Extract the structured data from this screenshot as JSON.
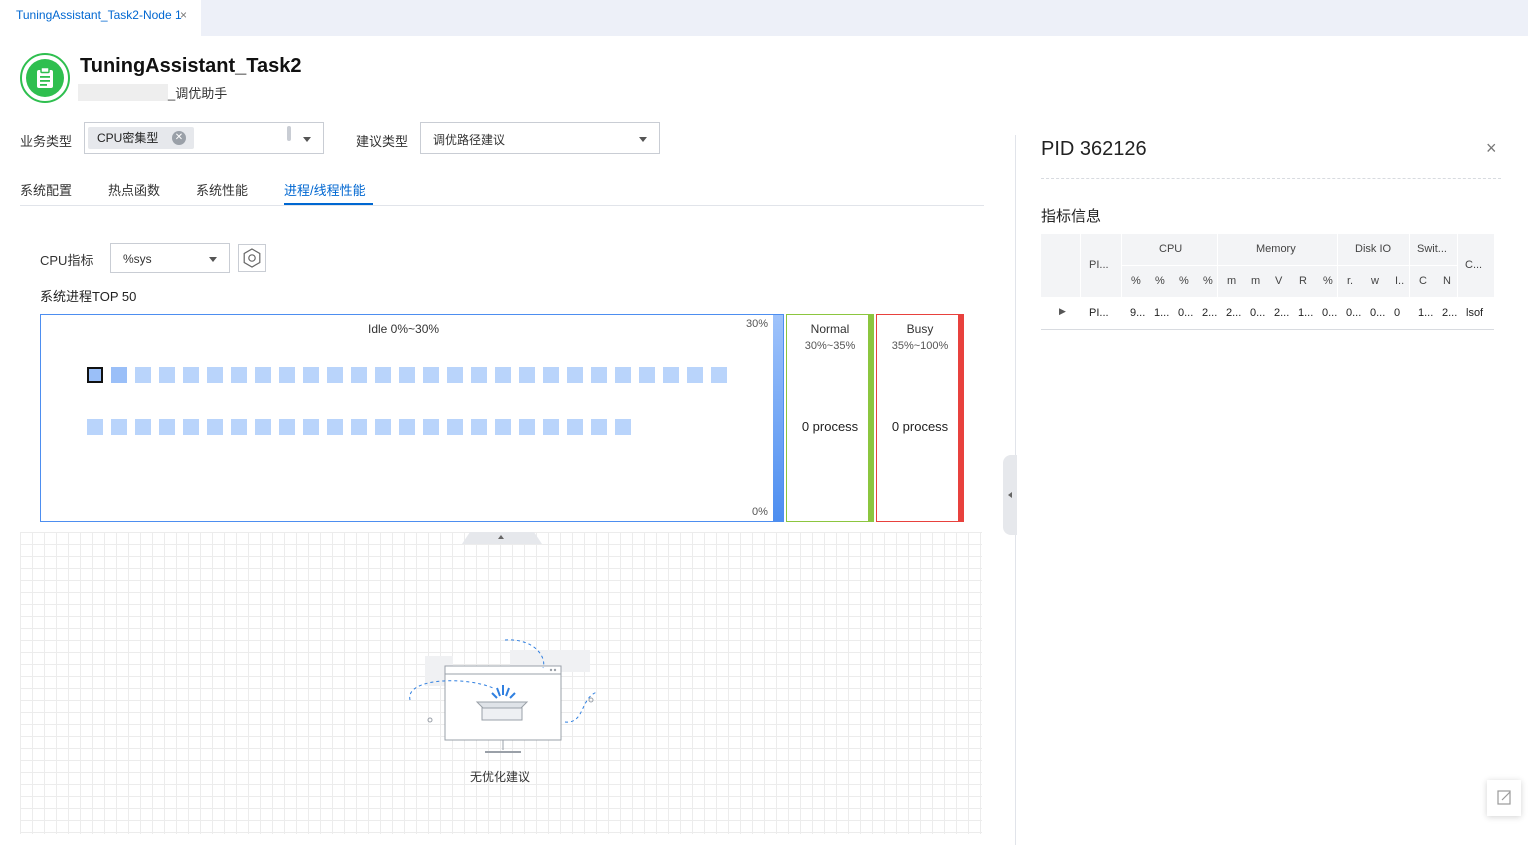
{
  "tab": {
    "label": "TuningAssistant_Task2-Node 1",
    "close": "×"
  },
  "header": {
    "title": "TuningAssistant_Task2",
    "subtitle": "_调优助手"
  },
  "filters": {
    "business_label": "业务类型",
    "business_chip": "CPU密集型",
    "suggest_label": "建议类型",
    "suggest_value": "调优路径建议"
  },
  "nav": {
    "tabs": [
      "系统配置",
      "热点函数",
      "系统性能",
      "进程/线程性能"
    ],
    "active": 3
  },
  "cpu": {
    "label": "CPU指标",
    "select_value": "%sys"
  },
  "top50": {
    "title": "系统进程TOP 50"
  },
  "zones": {
    "idle": {
      "label": "Idle 0%~30%",
      "top_pct": "30%",
      "bottom_pct": "0%",
      "row1_count": 27,
      "row2_count": 23
    },
    "normal": {
      "name": "Normal",
      "range": "30%~35%",
      "count": "0 process"
    },
    "busy": {
      "name": "Busy",
      "range": "35%~100%",
      "count": "0 process"
    }
  },
  "empty": {
    "text": "无优化建议"
  },
  "panel": {
    "title": "PID 362126",
    "close": "×",
    "section": "指标信息",
    "groups": [
      "CPU",
      "Memory",
      "Disk IO",
      "Swit...",
      "C..."
    ],
    "first_col": "PI...",
    "sub_headers": [
      "%",
      "%",
      "%",
      "%",
      "m",
      "m",
      "V",
      "R",
      "%",
      "r.",
      "w",
      "I..",
      "C",
      "N"
    ],
    "row": [
      "PI...",
      "9...",
      "1...",
      "0...",
      "2...",
      "2...",
      "0...",
      "2...",
      "1...",
      "0...",
      "0...",
      "0...",
      "0",
      "1...",
      "2...",
      "lsof"
    ]
  },
  "colors": {
    "accent": "#0067d1",
    "idle": "#4d8ef0",
    "normal": "#8cc63f",
    "busy": "#e8413d",
    "logo": "#2fbf4f"
  }
}
